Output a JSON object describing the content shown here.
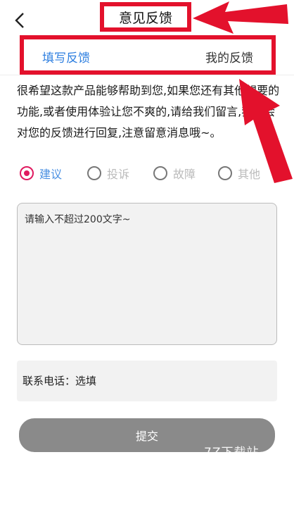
{
  "header": {
    "title": "意见反馈",
    "back_icon": "chevron-left-icon"
  },
  "tabs": [
    {
      "label": "填写反馈",
      "active": true
    },
    {
      "label": "我的反馈",
      "active": false
    }
  ],
  "description": "很希望这款产品能够帮助到您,如果您还有其他想要的功能,或者使用体验让您不爽的,请给我们留言,我们会对您的反馈进行回复,注意留意消息哦~。",
  "feedback_types": [
    {
      "label": "建议",
      "checked": true
    },
    {
      "label": "投诉",
      "checked": false
    },
    {
      "label": "故障",
      "checked": false
    },
    {
      "label": "其他",
      "checked": false
    }
  ],
  "content_input": {
    "placeholder": "请输入不超过200文字~",
    "value": ""
  },
  "phone_input": {
    "placeholder": "联系电话：选填",
    "value": ""
  },
  "submit": {
    "label": "提交"
  },
  "watermark": {
    "text": "7Z下载站"
  },
  "colors": {
    "annotation_red": "#e3112c",
    "tab_active": "#2e7fe0",
    "radio_checked": "#e0195f",
    "radio_checked_label": "#4a90e2",
    "submit_bg": "#8a8a8a"
  }
}
